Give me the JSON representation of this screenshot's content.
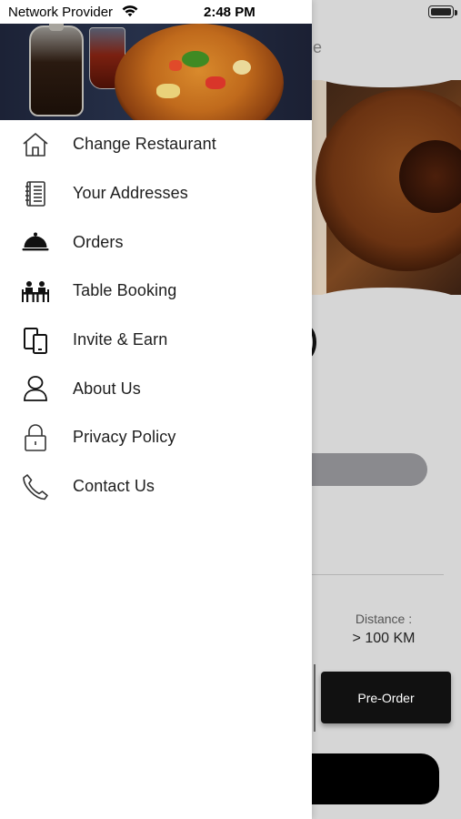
{
  "status_bar": {
    "carrier": "Network Provider",
    "time": "2:48 PM"
  },
  "drawer": {
    "hero_image": "soup-dish-photo",
    "menu": [
      {
        "label": "Change Restaurant",
        "icon": "home-icon"
      },
      {
        "label": "Your Addresses",
        "icon": "address-book-icon"
      },
      {
        "label": "Orders",
        "icon": "cloche-icon"
      },
      {
        "label": "Table Booking",
        "icon": "dining-table-icon"
      },
      {
        "label": "Invite & Earn",
        "icon": "share-devices-icon"
      },
      {
        "label": "About Us",
        "icon": "person-icon"
      },
      {
        "label": "Privacy Policy",
        "icon": "lock-icon"
      },
      {
        "label": "Contact Us",
        "icon": "phone-icon"
      }
    ]
  },
  "background_screen": {
    "header_partial": "e",
    "distance_label": "Distance :",
    "distance_value": "> 100 KM",
    "preorder_label": "Pre-Order"
  },
  "colors": {
    "drawer_bg": "#ffffff",
    "overlay_dim": "#d6d6d6",
    "menu_text": "#1e1e1e",
    "button_dark": "#111111"
  }
}
